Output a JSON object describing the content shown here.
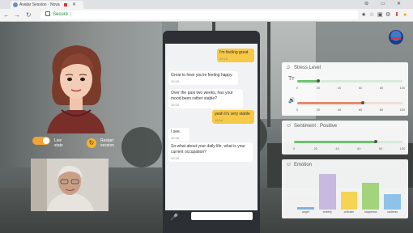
{
  "browser": {
    "tab_title": "Avatar Session · Nova",
    "tab_close": "✕",
    "address": "Secure",
    "address_sep": "|",
    "win_controls": [
      "⊖",
      "▭",
      "✕"
    ],
    "nav": {
      "back": "←",
      "forward": "→",
      "reload": "↻"
    },
    "extensions": [
      "★",
      "☆",
      "▣",
      "⚙",
      "⬇",
      "●"
    ]
  },
  "controls": {
    "live_label": "Live\nstate",
    "restart_label": "Restart\nsession",
    "restart_icon": "↻",
    "live_on": true
  },
  "chat": {
    "messages": [
      {
        "from": "user",
        "text": "I'm feeling great",
        "time": "10:15"
      },
      {
        "from": "bot",
        "text": "Great to hear you're feeling happy.",
        "time": "10:15"
      },
      {
        "from": "bot",
        "text": "Over the past two weeks, has your mood been rather stable?",
        "time": "10:15"
      },
      {
        "from": "user",
        "text": "yeah it's very stable",
        "time": "10:16"
      },
      {
        "from": "bot",
        "text": "I see.",
        "time": "10:16"
      },
      {
        "from": "bot",
        "text": "So what about your daily life, what is your current occupation?",
        "time": "10:16"
      }
    ],
    "mic_icon": "🎤",
    "input_value": ""
  },
  "stress": {
    "title": "Stress Level",
    "icon": "♫",
    "rows": [
      {
        "icon": "Tт",
        "value": 20,
        "color": "#6cc46c"
      },
      {
        "icon": "🔊",
        "value": 62,
        "color": "#e58a6b"
      }
    ],
    "ticks": [
      "0",
      "20",
      "40",
      "60",
      "80",
      "100"
    ]
  },
  "sentiment": {
    "title": "Sentiment : Positive",
    "icon": "☺",
    "value": 75,
    "color": "#6cc46c",
    "ticks": [
      "0",
      "20",
      "40",
      "60",
      "80",
      "100"
    ]
  },
  "emotion": {
    "title": "Emotion",
    "icon": "☺",
    "chart_data": {
      "type": "bar",
      "categories": [
        "anger",
        "anxiety",
        "criticism",
        "happiness",
        "sadness"
      ],
      "values": [
        2,
        32,
        16,
        24,
        14
      ],
      "colors": [
        "#7fb2e0",
        "#c7b9df",
        "#f5d453",
        "#a3d47c",
        "#8fc2e9"
      ],
      "ylim": [
        0,
        35
      ]
    }
  }
}
